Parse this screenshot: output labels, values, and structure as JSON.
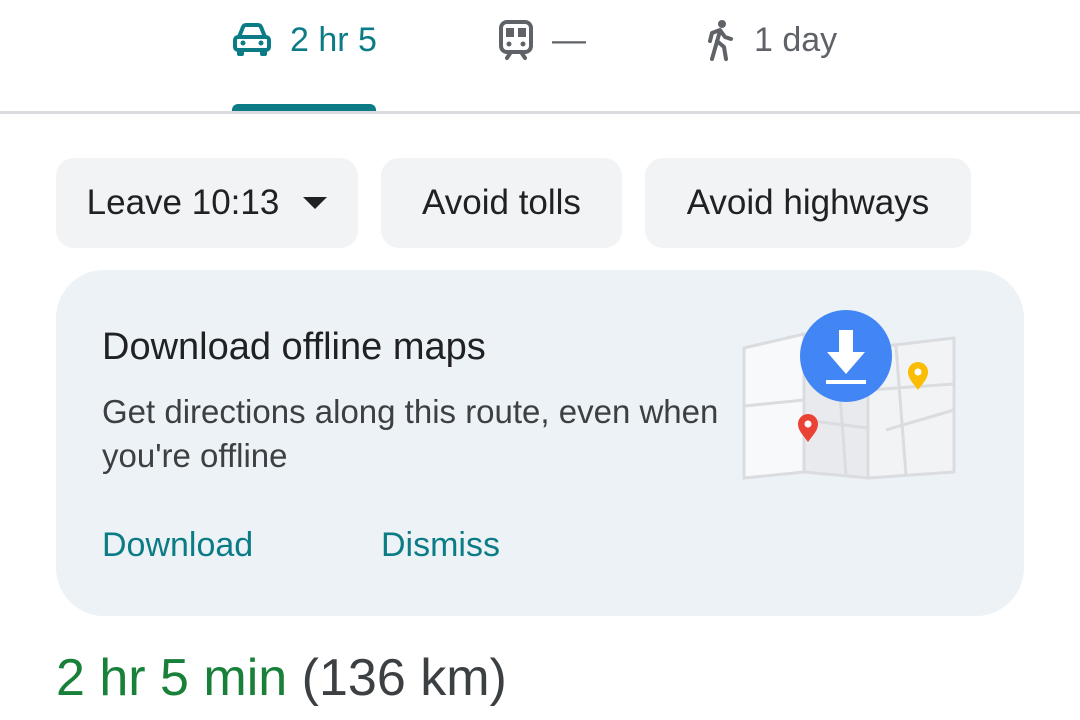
{
  "mode_tabs": [
    {
      "mode": "car-icon",
      "label": "2 hr 5",
      "selected": true
    },
    {
      "mode": "train-icon",
      "label": "—",
      "selected": false
    },
    {
      "mode": "walk-icon",
      "label": "1 day",
      "selected": false
    }
  ],
  "options": {
    "leave": "Leave 10:13",
    "avoid_tolls": "Avoid tolls",
    "avoid_highways": "Avoid highways"
  },
  "offline_card": {
    "title": "Download offline maps",
    "body": "Get directions along this route, even when you're offline",
    "download": "Download",
    "dismiss": "Dismiss"
  },
  "summary": {
    "time": "2 hr 5 min",
    "distance": "(136 km)"
  },
  "colors": {
    "accent": "#0b7c86",
    "route_time": "#188038",
    "card_bg": "#edf2f6",
    "chip_bg": "#f1f3f4",
    "download_badge": "#4285f4",
    "pin_red": "#ea4335",
    "pin_yellow": "#fbbc04"
  }
}
